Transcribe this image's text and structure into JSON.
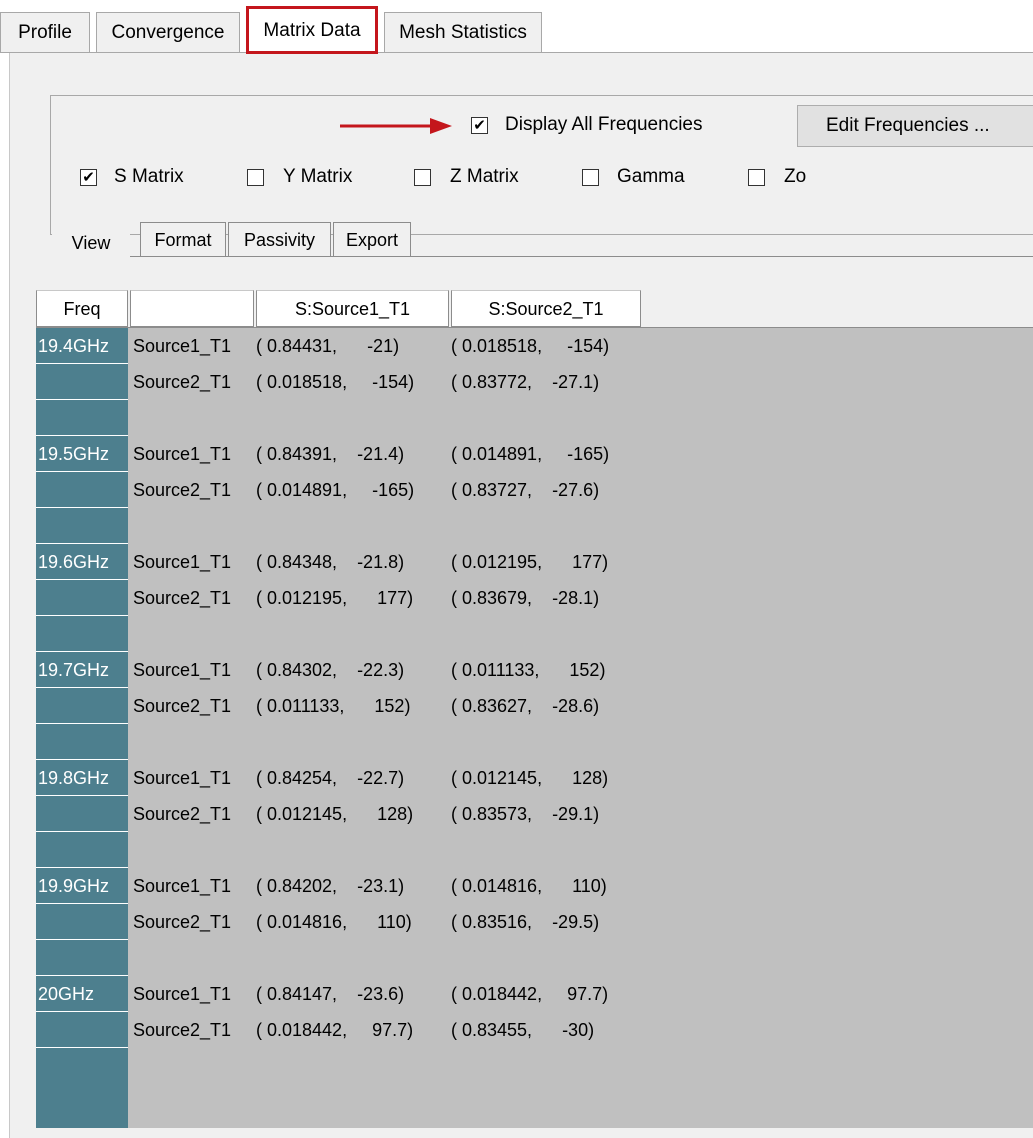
{
  "tabs": [
    "Profile",
    "Convergence",
    "Matrix Data",
    "Mesh Statistics"
  ],
  "active_tab": "Matrix Data",
  "display_all": {
    "label": "Display All Frequencies",
    "checked": true
  },
  "edit_button": "Edit Frequencies ...",
  "matrix_options": [
    {
      "label": "S Matrix",
      "checked": true
    },
    {
      "label": "Y Matrix",
      "checked": false
    },
    {
      "label": "Z Matrix",
      "checked": false
    },
    {
      "label": "Gamma",
      "checked": false
    },
    {
      "label": "Zo",
      "checked": false
    }
  ],
  "sub_tabs": [
    "View",
    "Format",
    "Passivity",
    "Export"
  ],
  "active_sub_tab": "View",
  "columns": [
    "Freq",
    "",
    "S:Source1_T1",
    "S:Source2_T1"
  ],
  "colors": {
    "freq_bg": "#4d7f8e",
    "grid_bg": "#c0c0c0",
    "highlight": "#c4161c"
  },
  "rows": [
    {
      "freq": "19.4GHz",
      "label": "Source1_T1",
      "c1": "( 0.84431,      -21)",
      "c2": "( 0.018518,     -154)"
    },
    {
      "freq": "",
      "label": "Source2_T1",
      "c1": "( 0.018518,     -154)",
      "c2": "( 0.83772,    -27.1)"
    },
    {
      "freq": "",
      "label": "",
      "c1": "",
      "c2": ""
    },
    {
      "freq": "19.5GHz",
      "label": "Source1_T1",
      "c1": "( 0.84391,    -21.4)",
      "c2": "( 0.014891,     -165)"
    },
    {
      "freq": "",
      "label": "Source2_T1",
      "c1": "( 0.014891,     -165)",
      "c2": "( 0.83727,    -27.6)"
    },
    {
      "freq": "",
      "label": "",
      "c1": "",
      "c2": ""
    },
    {
      "freq": "19.6GHz",
      "label": "Source1_T1",
      "c1": "( 0.84348,    -21.8)",
      "c2": "( 0.012195,      177)"
    },
    {
      "freq": "",
      "label": "Source2_T1",
      "c1": "( 0.012195,      177)",
      "c2": "( 0.83679,    -28.1)"
    },
    {
      "freq": "",
      "label": "",
      "c1": "",
      "c2": ""
    },
    {
      "freq": "19.7GHz",
      "label": "Source1_T1",
      "c1": "( 0.84302,    -22.3)",
      "c2": "( 0.011133,      152)"
    },
    {
      "freq": "",
      "label": "Source2_T1",
      "c1": "( 0.011133,      152)",
      "c2": "( 0.83627,    -28.6)"
    },
    {
      "freq": "",
      "label": "",
      "c1": "",
      "c2": ""
    },
    {
      "freq": "19.8GHz",
      "label": "Source1_T1",
      "c1": "( 0.84254,    -22.7)",
      "c2": "( 0.012145,      128)"
    },
    {
      "freq": "",
      "label": "Source2_T1",
      "c1": "( 0.012145,      128)",
      "c2": "( 0.83573,    -29.1)"
    },
    {
      "freq": "",
      "label": "",
      "c1": "",
      "c2": ""
    },
    {
      "freq": "19.9GHz",
      "label": "Source1_T1",
      "c1": "( 0.84202,    -23.1)",
      "c2": "( 0.014816,      110)"
    },
    {
      "freq": "",
      "label": "Source2_T1",
      "c1": "( 0.014816,      110)",
      "c2": "( 0.83516,    -29.5)"
    },
    {
      "freq": "",
      "label": "",
      "c1": "",
      "c2": ""
    },
    {
      "freq": "20GHz",
      "label": "Source1_T1",
      "c1": "( 0.84147,    -23.6)",
      "c2": "( 0.018442,     97.7)"
    },
    {
      "freq": "",
      "label": "Source2_T1",
      "c1": "( 0.018442,     97.7)",
      "c2": "( 0.83455,      -30)"
    }
  ]
}
